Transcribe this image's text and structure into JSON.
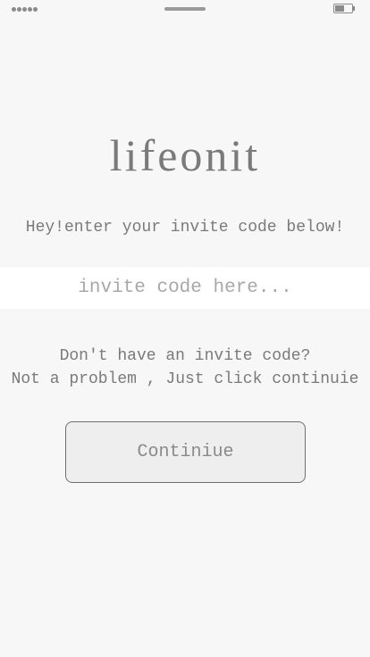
{
  "colors": {
    "background": "#f7f7f7",
    "input_background": "#ffffff",
    "text": "#7a7a7a",
    "placeholder": "#a8a8a8",
    "button_background": "#eeeeee",
    "button_border": "#6f6f6f"
  },
  "status_bar": {
    "signal_icon": "signal-dots-icon",
    "battery_icon": "battery-icon"
  },
  "app": {
    "title": "lifeonit",
    "subtitle": "Hey!enter your invite code below!"
  },
  "invite": {
    "value": "",
    "placeholder": "invite code here..."
  },
  "help": {
    "line1": "Don't have an invite code?",
    "line2": "Not a problem , Just click continuie"
  },
  "actions": {
    "continue_label": "Continiue"
  }
}
